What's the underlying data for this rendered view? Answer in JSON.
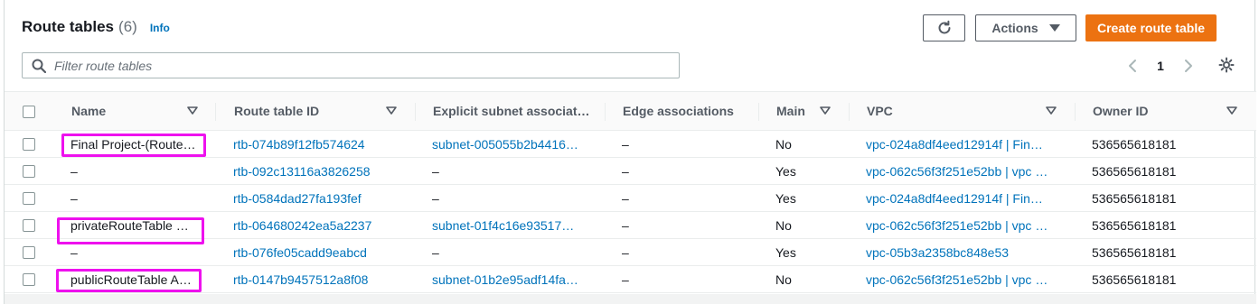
{
  "header": {
    "title": "Route tables",
    "count": "(6)",
    "info": "Info"
  },
  "toolbar": {
    "refresh_icon": "refresh-icon",
    "actions_label": "Actions",
    "create_label": "Create route table",
    "create_color": "#ec7211"
  },
  "search": {
    "placeholder": "Filter route tables",
    "value": ""
  },
  "pagination": {
    "current_page": "1"
  },
  "table": {
    "columns": [
      "Name",
      "Route table ID",
      "Explicit subnet associat…",
      "Edge associations",
      "Main",
      "VPC",
      "Owner ID"
    ],
    "rows": [
      {
        "name": "Final Project-(Route…",
        "route_table_id": "rtb-074b89f12fb574624",
        "subnet": "subnet-005055b2b4416…",
        "edge": "–",
        "main": "No",
        "vpc": "vpc-024a8df4eed12914f | Fin…",
        "owner": "536565618181",
        "highlighted": true
      },
      {
        "name": "–",
        "route_table_id": "rtb-092c13116a3826258",
        "subnet": "–",
        "edge": "–",
        "main": "Yes",
        "vpc": "vpc-062c56f3f251e52bb | vpc …",
        "owner": "536565618181",
        "highlighted": false
      },
      {
        "name": "–",
        "route_table_id": "rtb-0584dad27fa193fef",
        "subnet": "–",
        "edge": "–",
        "main": "Yes",
        "vpc": "vpc-024a8df4eed12914f | Fin…",
        "owner": "536565618181",
        "highlighted": false
      },
      {
        "name": "privateRouteTable …",
        "route_table_id": "rtb-064680242ea5a2237",
        "subnet": "subnet-01f4c16e93517…",
        "edge": "–",
        "main": "No",
        "vpc": "vpc-062c56f3f251e52bb | vpc …",
        "owner": "536565618181",
        "highlighted": true
      },
      {
        "name": "–",
        "route_table_id": "rtb-076fe05cadd9eabcd",
        "subnet": "–",
        "edge": "–",
        "main": "Yes",
        "vpc": "vpc-05b3a2358bc848e53",
        "owner": "536565618181",
        "highlighted": false
      },
      {
        "name": "publicRouteTable A…",
        "route_table_id": "rtb-0147b9457512a8f08",
        "subnet": "subnet-01b2e95adf14fa…",
        "edge": "–",
        "main": "No",
        "vpc": "vpc-062c56f3f251e52bb | vpc …",
        "owner": "536565618181",
        "highlighted": true
      }
    ]
  },
  "colors": {
    "link": "#0073bb",
    "highlight": "#ee11ee"
  }
}
